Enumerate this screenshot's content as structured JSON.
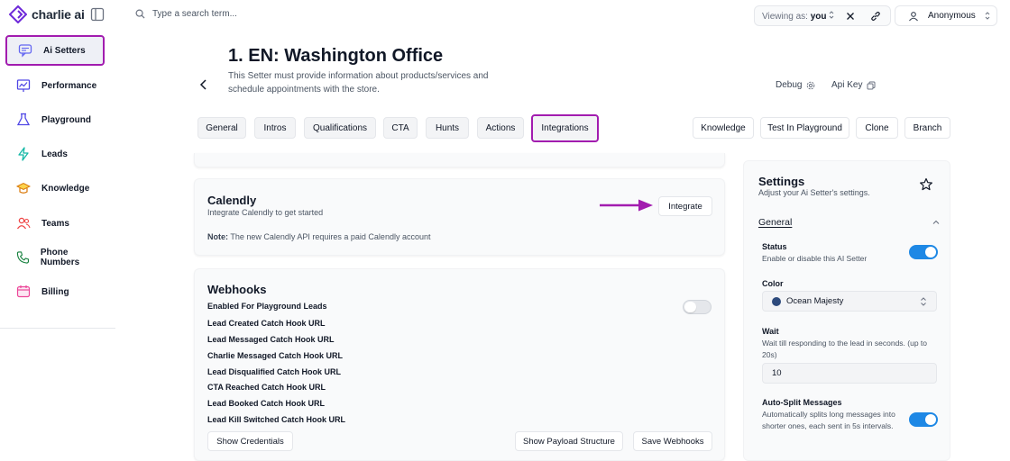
{
  "brand": {
    "name": "charlie ai",
    "accent": "#a21caf",
    "primary": "#1e88e5"
  },
  "sidebar": {
    "items": [
      {
        "label": "Ai Setters",
        "icon": "chat-icon",
        "active": true
      },
      {
        "label": "Performance",
        "icon": "chart-icon"
      },
      {
        "label": "Playground",
        "icon": "flask-icon"
      },
      {
        "label": "Leads",
        "icon": "lightning-icon"
      },
      {
        "label": "Knowledge",
        "icon": "graduation-cap-icon"
      },
      {
        "label": "Teams",
        "icon": "users-icon"
      },
      {
        "label": "Phone Numbers",
        "icon": "phone-icon"
      },
      {
        "label": "Billing",
        "icon": "calendar-card-icon"
      }
    ]
  },
  "topbar": {
    "search_placeholder": "Type a search term...",
    "viewing_prefix": "Viewing as:",
    "viewing_value": "you",
    "user_name": "Anonymous"
  },
  "header": {
    "title": "1. EN: Washington Office",
    "description": "This Setter must provide information about products/services and schedule appointments with the store.",
    "debug_label": "Debug",
    "api_key_label": "Api Key"
  },
  "tabs": [
    {
      "label": "General"
    },
    {
      "label": "Intros"
    },
    {
      "label": "Qualifications"
    },
    {
      "label": "CTA"
    },
    {
      "label": "Hunts"
    },
    {
      "label": "Actions"
    },
    {
      "label": "Integrations",
      "active": true
    }
  ],
  "right_actions": [
    "Knowledge",
    "Test In Playground",
    "Clone",
    "Branch"
  ],
  "calendly": {
    "title": "Calendly",
    "subtitle": "Integrate Calendly to get started",
    "button": "Integrate",
    "note_label": "Note:",
    "note_text": "The new Calendly API requires a paid Calendly account"
  },
  "webhooks": {
    "title": "Webhooks",
    "playground_toggle_label": "Enabled For Playground Leads",
    "playground_enabled": false,
    "hooks": [
      "Lead Created Catch Hook URL",
      "Lead Messaged Catch Hook URL",
      "Charlie Messaged Catch Hook URL",
      "Lead Disqualified Catch Hook URL",
      "CTA Reached Catch Hook URL",
      "Lead Booked Catch Hook URL",
      "Lead Kill Switched Catch Hook URL"
    ],
    "show_credentials": "Show Credentials",
    "show_payload": "Show Payload Structure",
    "save": "Save Webhooks"
  },
  "settings": {
    "title": "Settings",
    "subtitle": "Adjust your Ai Setter's settings.",
    "section": "General",
    "status_label": "Status",
    "status_desc": "Enable or disable this AI Setter",
    "status_on": true,
    "color_label": "Color",
    "color_value": "Ocean Majesty",
    "color_hex": "#2d4a7c",
    "wait_label": "Wait",
    "wait_desc": "Wait till responding to the lead in seconds. (up to 20s)",
    "wait_value": "10",
    "autosplit_label": "Auto-Split Messages",
    "autosplit_desc": "Automatically splits long messages into shorter ones, each sent in 5s intervals.",
    "autosplit_on": true
  }
}
